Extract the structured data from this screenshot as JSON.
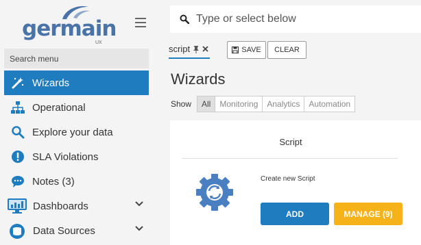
{
  "logo": {
    "text": "germain",
    "sub": "UX"
  },
  "sidebar": {
    "search_placeholder": "Search menu",
    "items": [
      {
        "label": "Wizards",
        "icon": "wand-icon",
        "active": true
      },
      {
        "label": "Operational",
        "icon": "org-chart-icon"
      },
      {
        "label": "Explore your data",
        "icon": "search-icon"
      },
      {
        "label": "SLA Violations",
        "icon": "alert-icon"
      },
      {
        "label": "Notes (3)",
        "icon": "chat-icon"
      },
      {
        "label": "Dashboards",
        "icon": "dashboard-monitor-icon",
        "expandable": true
      },
      {
        "label": "Data Sources",
        "icon": "database-icon",
        "expandable": true
      }
    ]
  },
  "topbar": {
    "search_placeholder": "Type or select below"
  },
  "active_tab": {
    "label": "script"
  },
  "toolbar": {
    "save_label": "SAVE",
    "clear_label": "CLEAR"
  },
  "page": {
    "title": "Wizards",
    "show_label": "Show"
  },
  "filters": [
    {
      "label": "All",
      "selected": true
    },
    {
      "label": "Monitoring"
    },
    {
      "label": "Analytics"
    },
    {
      "label": "Automation"
    }
  ],
  "card": {
    "title": "Script",
    "description": "Create new Script",
    "add_label": "ADD",
    "manage_label": "MANAGE (9)"
  },
  "colors": {
    "accent": "#1e7cbf",
    "manage": "#f5b319",
    "logo": "#4a73a8"
  }
}
